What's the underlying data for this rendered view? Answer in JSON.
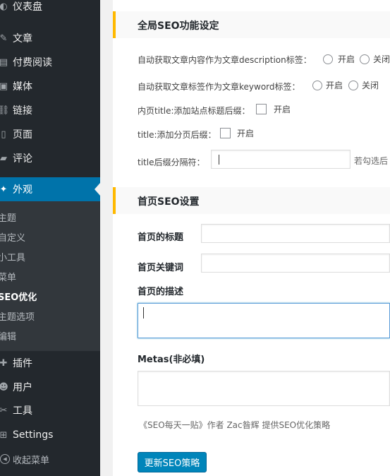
{
  "sidebar": {
    "items_top": [
      {
        "label": "仪表盘",
        "icon": "dashboard-icon",
        "glyph": "◐"
      },
      {
        "label": "文章",
        "icon": "pin-icon",
        "glyph": "✎"
      },
      {
        "label": "付费阅读",
        "icon": "paid-reading-icon",
        "glyph": "▤"
      },
      {
        "label": "媒体",
        "icon": "media-icon",
        "glyph": "▣"
      },
      {
        "label": "链接",
        "icon": "link-icon",
        "glyph": "⛓"
      },
      {
        "label": "页面",
        "icon": "page-icon",
        "glyph": "▯"
      },
      {
        "label": "评论",
        "icon": "comment-icon",
        "glyph": "▰"
      },
      {
        "label": "外观",
        "icon": "appearance-icon",
        "glyph": "✦"
      }
    ],
    "submenu": [
      "主题",
      "自定义",
      "小工具",
      "菜单",
      "SEO优化",
      "主题选项",
      "编辑"
    ],
    "items_bottom": [
      {
        "label": "插件",
        "icon": "plugin-icon",
        "glyph": "✚"
      },
      {
        "label": "用户",
        "icon": "user-icon",
        "glyph": "☻"
      },
      {
        "label": "工具",
        "icon": "tools-icon",
        "glyph": "✂"
      },
      {
        "label": "Settings",
        "icon": "settings-icon",
        "glyph": "⊞"
      },
      {
        "label": "收起菜单",
        "icon": "collapse-icon",
        "glyph": "◀"
      }
    ]
  },
  "global_seo": {
    "title": "全局SEO功能设定",
    "description_label": "自动获取文章内容作为文章description标签：",
    "keyword_label": "自动获取文章标签作为文章keyword标签：",
    "opt_on": "开启",
    "opt_off": "关闭",
    "title_site_suffix_label": "内页title:添加站点标题后缀：",
    "title_page_suffix_label": "title:添加分页后缀：",
    "enable": "开启",
    "separator_label": "title后缀分隔符：",
    "separator_hint": "若勾选后"
  },
  "home_seo": {
    "title": "首页SEO设置",
    "home_title_label": "首页的标题",
    "home_keywords_label": "首页关键词",
    "home_desc_label": "首页的描述",
    "metas_label": "Metas(非必填)",
    "credit": "《SEO每天一贴》作者 Zac昝辉 提供SEO优化策略",
    "submit": "更新SEO策略"
  }
}
